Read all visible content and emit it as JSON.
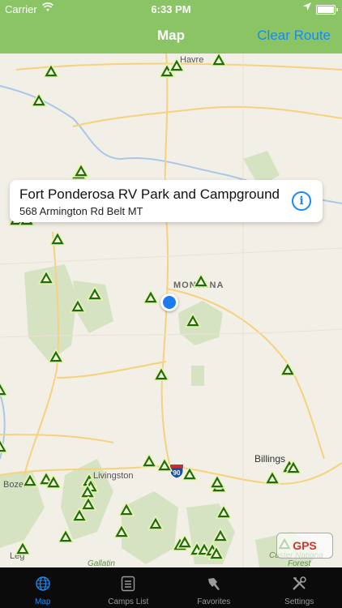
{
  "status": {
    "carrier": "Carrier",
    "time": "6:33 PM",
    "battery_level": 1.0
  },
  "nav": {
    "title": "Map",
    "clear_route": "Clear Route"
  },
  "map": {
    "labels": {
      "havre": "Havre",
      "montana": "MONTANA",
      "billings": "Billings",
      "livingston": "Livingston",
      "bozeman": "Bozem",
      "interstate": "90",
      "gallatin": "Gallatin",
      "custer": "Custer Nationa",
      "forest": "Forest",
      "leg": "Leg"
    },
    "gps_button": "GPS"
  },
  "callout": {
    "title": "Fort Ponderosa RV Park and Campground",
    "address": "568 Armington Rd Belt MT",
    "info_icon": "info-icon"
  },
  "tabs": [
    {
      "label": "Map",
      "icon": "globe-icon",
      "active": true
    },
    {
      "label": "Camps List",
      "icon": "list-icon",
      "active": false
    },
    {
      "label": "Favorites",
      "icon": "favorites-icon",
      "active": false
    },
    {
      "label": "Settings",
      "icon": "settings-icon",
      "active": false
    }
  ],
  "colors": {
    "navbar": "#8ac465",
    "accent": "#1a8af0",
    "marker": "#2f8f1f",
    "gps": "#d9302a"
  }
}
